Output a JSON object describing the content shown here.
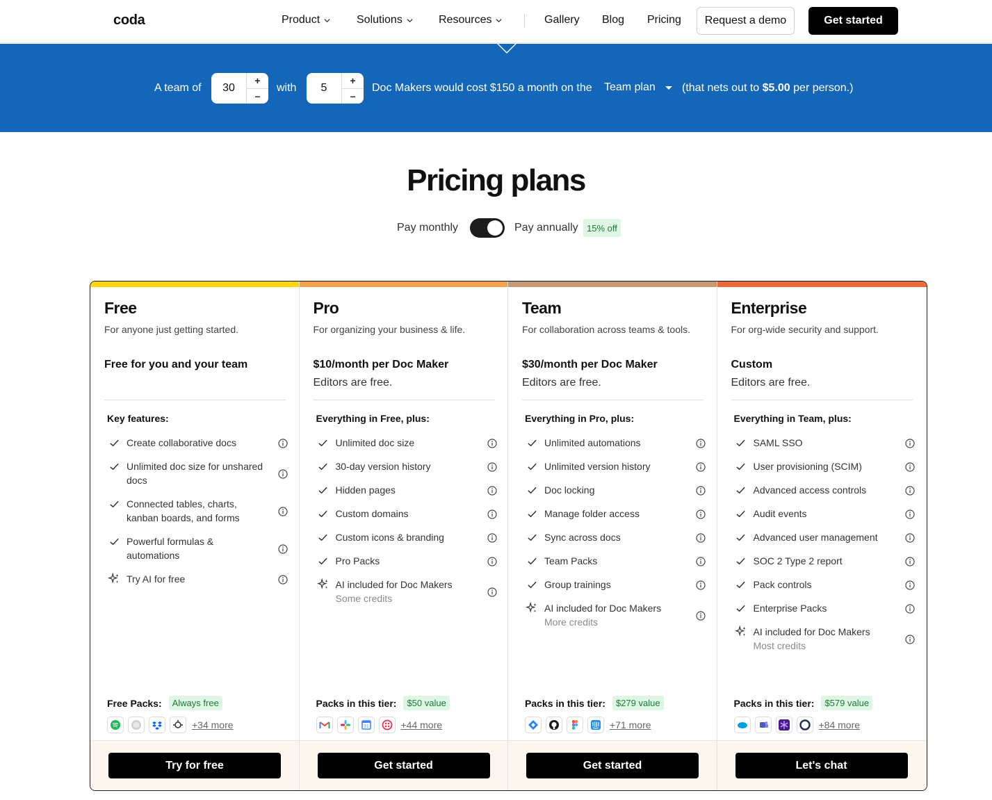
{
  "header": {
    "logo": "coda",
    "nav": [
      "Product",
      "Solutions",
      "Resources",
      "Gallery",
      "Blog",
      "Pricing"
    ],
    "request_demo": "Request a demo",
    "get_started": "Get started"
  },
  "calculator": {
    "prefix": "A team of",
    "team_size": "30",
    "with": "with",
    "doc_makers": "5",
    "middle": "Doc Makers would cost $150 a month on the",
    "plan": "Team plan",
    "suffix_start": "(that nets out to",
    "per_person": "$5.00",
    "suffix_end": "per person.)"
  },
  "title": "Pricing plans",
  "billing": {
    "monthly": "Pay monthly",
    "annually": "Pay annually",
    "discount": "15% off",
    "annual_selected": true
  },
  "colors": {
    "free": "#ffd60a",
    "pro": "#f5a24a",
    "team": "#c39a74",
    "enterprise": "#e86a3c",
    "band": "#1466b8"
  },
  "plans": [
    {
      "name": "Free",
      "desc": "For anyone just getting started.",
      "price": "Free for you and your team",
      "price_sub": "",
      "feat_head": "Key features:",
      "features": [
        {
          "t": "Create collaborative docs",
          "s": "",
          "icon": "check"
        },
        {
          "t": "Unlimited doc size for unshared docs",
          "s": "",
          "icon": "check"
        },
        {
          "t": "Connected tables, charts, kanban boards, and forms",
          "s": "",
          "icon": "check"
        },
        {
          "t": "Powerful formulas & automations",
          "s": "",
          "icon": "check"
        },
        {
          "t": "Try AI for free",
          "s": "",
          "icon": "sparkle"
        }
      ],
      "packs_label": "Free Packs:",
      "packs_badge": "Always free",
      "pack_icons": [
        "spotify-icon",
        "wikipedia-icon",
        "dropbox-icon",
        "openweather-icon"
      ],
      "packs_more": "+34 more",
      "cta": "Try for free"
    },
    {
      "name": "Pro",
      "desc": "For organizing your business & life.",
      "price": "$10/month per Doc Maker",
      "price_sub": "Editors are free.",
      "feat_head": "Everything in Free, plus:",
      "features": [
        {
          "t": "Unlimited doc size",
          "s": "",
          "icon": "check"
        },
        {
          "t": "30-day version history",
          "s": "",
          "icon": "check"
        },
        {
          "t": "Hidden pages",
          "s": "",
          "icon": "check"
        },
        {
          "t": "Custom domains",
          "s": "",
          "icon": "check"
        },
        {
          "t": "Custom icons & branding",
          "s": "",
          "icon": "check"
        },
        {
          "t": "Pro Packs",
          "s": "",
          "icon": "check"
        },
        {
          "t": "AI included for Doc Makers",
          "s": "Some credits",
          "icon": "sparkle"
        }
      ],
      "packs_label": "Packs in this tier:",
      "packs_badge": "$50 value",
      "pack_icons": [
        "gmail-icon",
        "slack-icon",
        "google-calendar-icon",
        "twilio-icon"
      ],
      "packs_more": "+44 more",
      "cta": "Get started"
    },
    {
      "name": "Team",
      "desc": "For collaboration across teams & tools.",
      "price": "$30/month per Doc Maker",
      "price_sub": "Editors are free.",
      "feat_head": "Everything in Pro, plus:",
      "features": [
        {
          "t": "Unlimited automations",
          "s": "",
          "icon": "check"
        },
        {
          "t": "Unlimited version history",
          "s": "",
          "icon": "check"
        },
        {
          "t": "Doc locking",
          "s": "",
          "icon": "check"
        },
        {
          "t": "Manage folder access",
          "s": "",
          "icon": "check"
        },
        {
          "t": "Sync across docs",
          "s": "",
          "icon": "check"
        },
        {
          "t": "Team Packs",
          "s": "",
          "icon": "check"
        },
        {
          "t": "Group trainings",
          "s": "",
          "icon": "check"
        },
        {
          "t": "AI included for Doc Makers",
          "s": "More credits",
          "icon": "sparkle"
        }
      ],
      "packs_label": "Packs in this tier:",
      "packs_badge": "$279 value",
      "pack_icons": [
        "jira-icon",
        "github-icon",
        "figma-icon",
        "intercom-icon"
      ],
      "packs_more": "+71 more",
      "cta": "Get started"
    },
    {
      "name": "Enterprise",
      "desc": "For org-wide security and support.",
      "price": "Custom",
      "price_sub": "Editors are free.",
      "feat_head": "Everything in Team, plus:",
      "features": [
        {
          "t": "SAML SSO",
          "s": "",
          "icon": "check"
        },
        {
          "t": "User provisioning (SCIM)",
          "s": "",
          "icon": "check"
        },
        {
          "t": "Advanced access controls",
          "s": "",
          "icon": "check"
        },
        {
          "t": "Audit events",
          "s": "",
          "icon": "check"
        },
        {
          "t": "Advanced user management",
          "s": "",
          "icon": "check"
        },
        {
          "t": "SOC 2 Type 2 report",
          "s": "",
          "icon": "check"
        },
        {
          "t": "Pack controls",
          "s": "",
          "icon": "check"
        },
        {
          "t": "Enterprise Packs",
          "s": "",
          "icon": "check"
        },
        {
          "t": "AI included for Doc Makers",
          "s": "Most credits",
          "icon": "sparkle"
        }
      ],
      "packs_label": "Packs in this tier:",
      "packs_badge": "$579 value",
      "pack_icons": [
        "salesforce-icon",
        "teams-icon",
        "snowflake-icon",
        "okta-icon"
      ],
      "packs_more": "+84 more",
      "cta": "Let's chat"
    }
  ]
}
